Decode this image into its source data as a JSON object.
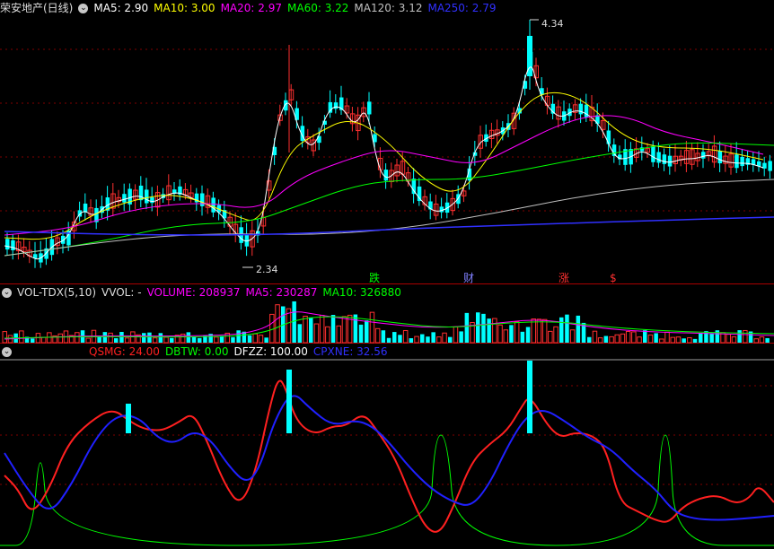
{
  "price_panel": {
    "title": "荣安地产(日线)",
    "ma_labels": [
      {
        "text": "MA5: 2.90",
        "color": "#ffffff"
      },
      {
        "text": "MA10: 3.00",
        "color": "#ffff00"
      },
      {
        "text": "MA20: 2.97",
        "color": "#ff00ff"
      },
      {
        "text": "MA60: 3.22",
        "color": "#00ff00"
      },
      {
        "text": "MA120: 3.12",
        "color": "#c0c0c0"
      },
      {
        "text": "MA250: 2.79",
        "color": "#3030ff"
      }
    ],
    "high_marker": "4.34",
    "low_marker": "2.34",
    "signals": [
      {
        "text": "跌",
        "color": "#00ff00"
      },
      {
        "text": "财",
        "color": "#8080ff"
      },
      {
        "text": "涨",
        "color": "#ff3030"
      },
      {
        "text": "$",
        "color": "#ff3030"
      }
    ]
  },
  "volume_panel": {
    "labels": [
      {
        "text": "VOL-TDX(5,10)",
        "color": "#dddddd"
      },
      {
        "text": "VVOL: -",
        "color": "#dddddd"
      },
      {
        "text": "VOLUME: 208937",
        "color": "#ff00ff"
      },
      {
        "text": "MA5: 230287",
        "color": "#ff00ff"
      },
      {
        "text": "MA10: 326880",
        "color": "#00ff00"
      }
    ]
  },
  "indicator_panel": {
    "labels": [
      {
        "text": "QSMG: 24.00",
        "color": "#ff2020"
      },
      {
        "text": "DBTW: 0.00",
        "color": "#00ff00"
      },
      {
        "text": "DFZZ: 100.00",
        "color": "#ffffff"
      },
      {
        "text": "CPXNE: 32.56",
        "color": "#3030ff"
      }
    ]
  },
  "colors": {
    "up": "#ff3030",
    "down": "#00ffff",
    "grid": "#800000"
  }
}
